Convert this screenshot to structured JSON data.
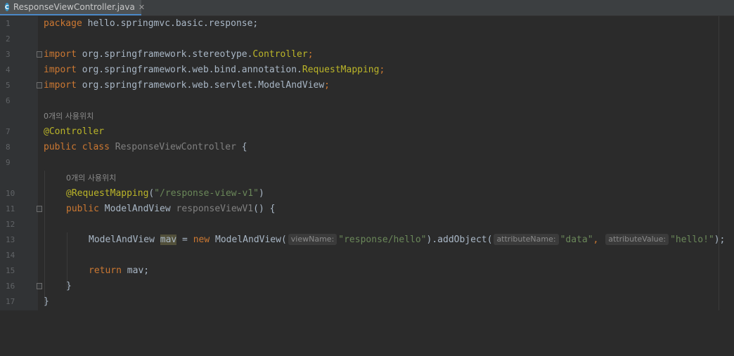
{
  "tab": {
    "icon_letter": "C",
    "filename": "ResponseViewController.java",
    "close_glyph": "✕"
  },
  "usage_hint": "0개의 사용위치",
  "lines": {
    "l1": {
      "num": "1",
      "kw": "package",
      "text": " hello.springmvc.basic.response;"
    },
    "l2": {
      "num": "2"
    },
    "l3": {
      "num": "3",
      "kw": "import",
      "pkg": " org.springframework.stereotype.",
      "cls": "Controller",
      "end": ";"
    },
    "l4": {
      "num": "4",
      "kw": "import",
      "pkg": " org.springframework.web.bind.annotation.",
      "cls": "RequestMapping",
      "end": ";"
    },
    "l5": {
      "num": "5",
      "kw": "import",
      "pkg": " org.springframework.web.servlet.ModelAndView",
      "end": ";"
    },
    "l6": {
      "num": "6"
    },
    "l7": {
      "num": "7",
      "ann": "@Controller"
    },
    "l8": {
      "num": "8",
      "kw1": "public",
      "kw2": "class",
      "name": " ResponseViewController",
      "brace": " {"
    },
    "l9": {
      "num": "9"
    },
    "l10": {
      "num": "10",
      "ann": "@RequestMapping",
      "open": "(",
      "str": "\"/response-view-v1\"",
      "close": ")"
    },
    "l11": {
      "num": "11",
      "kw": "public",
      "type": " ModelAndView ",
      "name": "responseViewV1",
      "rest": "() {"
    },
    "l12": {
      "num": "12"
    },
    "l13": {
      "num": "13",
      "type": "ModelAndView ",
      "var": "mav",
      "eq": " = ",
      "new": "new",
      "ctor": " ModelAndView(",
      "hint1": "viewName:",
      "str1": "\"response/hello\"",
      "mid": ").addObject(",
      "hint2": "attributeName:",
      "str2": "\"data\"",
      "comma": ",",
      "hint3": "attributeValue:",
      "str3": "\"hello!\"",
      "end": ");"
    },
    "l14": {
      "num": "14"
    },
    "l15": {
      "num": "15",
      "kw": "return",
      "rest": " mav;"
    },
    "l16": {
      "num": "16",
      "text": "}"
    },
    "l17": {
      "num": "17",
      "text": "}"
    }
  },
  "colors": {
    "background": "#2b2b2b",
    "keyword": "#cc7832",
    "annotation": "#bbb529",
    "string": "#6a8759",
    "text": "#a9b7c6"
  }
}
